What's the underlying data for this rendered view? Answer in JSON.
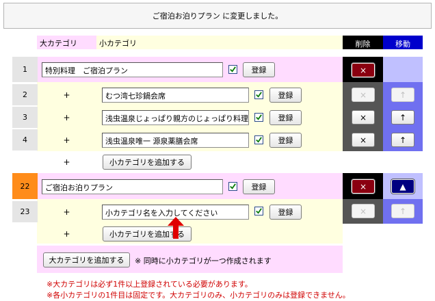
{
  "notice": "ご宿泊お泊りプラン に変更しました。",
  "headers": {
    "major": "大カテゴリ",
    "minor": "小カテゴリ",
    "delete": "削除",
    "move": "移動"
  },
  "colors": {
    "major_bg": "#ffdcff",
    "minor_bg": "#ffffe0",
    "delete_col": "#000000",
    "move_col": "#0000cc",
    "highlight": "#ff8c1a"
  },
  "groups": [
    {
      "number": "1",
      "name": "特別料理　ご宿泊プラン",
      "register_label": "登録",
      "delete_icon": "×",
      "items": [
        {
          "number": "2",
          "plus": "+",
          "name": "むつ湾七珍鍋会席",
          "register_label": "登録",
          "delete_icon": "×",
          "move_icon": "↑"
        },
        {
          "number": "3",
          "plus": "+",
          "name": "浅虫温泉じょっぱり親方のじょっぱり料理",
          "register_label": "登録",
          "delete_icon": "×",
          "move_icon": "↑"
        },
        {
          "number": "4",
          "plus": "+",
          "name": "浅虫温泉唯一 源泉薬膳会席",
          "register_label": "登録",
          "delete_icon": "×",
          "move_icon": "↑"
        }
      ],
      "add_plus": "+",
      "add_minor_label": "小カテゴリを追加する"
    },
    {
      "number": "22",
      "name": "ご宿泊お泊りプラン",
      "register_label": "登録",
      "delete_icon": "×",
      "move_icon": "▲",
      "items": [
        {
          "number": "23",
          "plus": "+",
          "name": "小カテゴリ名を入力してください",
          "register_label": "登録",
          "delete_icon": "×",
          "move_icon": "↑"
        }
      ],
      "add_plus": "+",
      "add_minor_label": "小カテゴリを追加する"
    }
  ],
  "add_major_label": "大カテゴリを追加する",
  "add_major_note": "※ 同時に小カテゴリが一つ作成されます",
  "notes": [
    "※大カテゴリは必ず1件以上登録されている必要があります。",
    "※各小カテゴリの1件目は固定です。大カテゴリのみ、小カテゴリのみは登録できません。"
  ]
}
